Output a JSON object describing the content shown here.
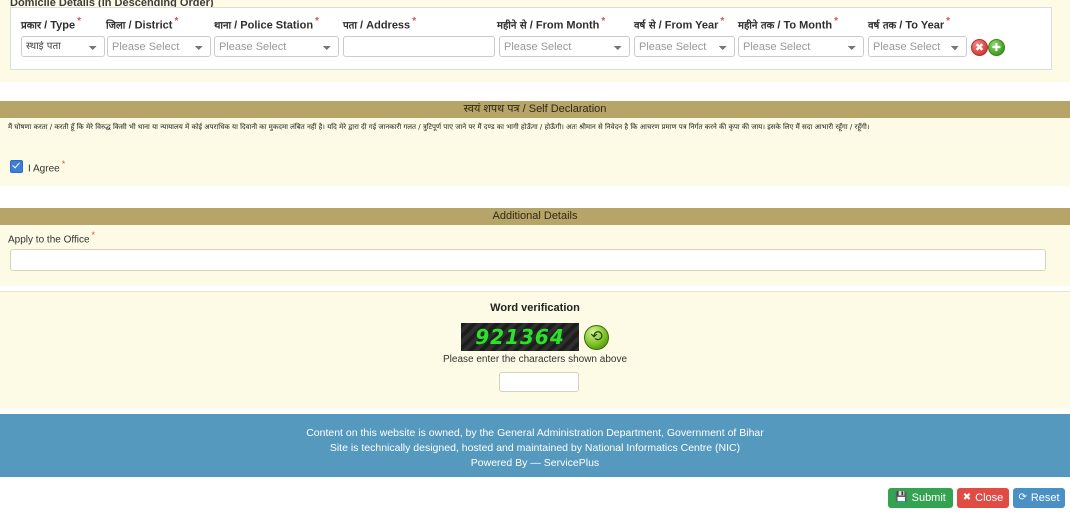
{
  "domicile": {
    "title": "Domicile Details (in Descending Order)",
    "fields": [
      {
        "label_hi": "प्रकार",
        "label_en": "Type",
        "required": true,
        "value": "स्थाई पता",
        "placeholder": "Please Select",
        "control": "select"
      },
      {
        "label_hi": "जिला",
        "label_en": "District",
        "required": true,
        "value": "",
        "placeholder": "Please Select",
        "control": "select"
      },
      {
        "label_hi": "थाना",
        "label_en": "Police Station",
        "required": true,
        "value": "",
        "placeholder": "Please Select",
        "control": "select"
      },
      {
        "label_hi": "पता",
        "label_en": "Address",
        "required": true,
        "value": "",
        "placeholder": "",
        "control": "text"
      },
      {
        "label_hi": "महीने से",
        "label_en": "From Month",
        "required": true,
        "value": "",
        "placeholder": "Please Select",
        "control": "select"
      },
      {
        "label_hi": "वर्ष से",
        "label_en": "From Year",
        "required": true,
        "value": "",
        "placeholder": "Please Select",
        "control": "select"
      },
      {
        "label_hi": "महीने तक",
        "label_en": "To Month",
        "required": true,
        "value": "",
        "placeholder": "Please Select",
        "control": "select"
      },
      {
        "label_hi": "वर्ष तक",
        "label_en": "To Year",
        "required": true,
        "value": "",
        "placeholder": "Please Select",
        "control": "select"
      }
    ],
    "remove_row_icon": "remove-circle-icon",
    "add_row_icon": "add-circle-icon"
  },
  "self_declaration": {
    "heading": "स्वयं शपथ पत्र / Self Declaration",
    "text": "मैं घोषणा करता / करती हूँ कि मेरे विरुद्ध किसी भी थाना या न्यायालय में कोई अपराधिक या दिवानी का मुकदमा लंबित नहीं है। यदि मेरे द्वारा दी गई जानकारी गलत / त्रुटिपूर्ण पाए जाने पर मैं दण्ड का भागी होऊँगा / होऊँगी। अतः श्रीमान से निवेदन है कि आचरण प्रमाण पत्र निर्गत करने की कृपा की जाय। इसके लिए मैं सदा आभारी रहूँगा / रहूँगी।",
    "agree_label": "I Agree",
    "agree_required": true,
    "agree_checked": true
  },
  "additional_details": {
    "heading": "Additional Details",
    "office_label": "Apply to the Office",
    "office_required": true,
    "office_value": "",
    "office_placeholder": ""
  },
  "word_verification": {
    "title": "Word verification",
    "captcha_text": "921364",
    "refresh_icon": "refresh-icon",
    "hint": "Please enter the characters shown above",
    "input_value": "",
    "input_placeholder": ""
  },
  "footer": {
    "line1": "Content on this website is owned, by the General Administration Department, Government of Bihar",
    "line2": "Site is technically designed, hosted and maintained by National Informatics Centre (NIC)",
    "line3": "Powered By — ServicePlus"
  },
  "actions": {
    "submit_label": "Submit",
    "submit_icon": "save-icon",
    "close_label": "Close",
    "close_icon": "close-circle-icon",
    "reset_label": "Reset",
    "reset_icon": "refresh-icon"
  },
  "colors": {
    "section_header": "#b7a468",
    "panel_bg": "#fdfbe5",
    "footer_bg": "#5599bf",
    "submit": "#33a352",
    "close": "#e04b44",
    "reset": "#4a90c4",
    "captcha_text": "#2ee02e",
    "required_star": "#d9534f"
  }
}
